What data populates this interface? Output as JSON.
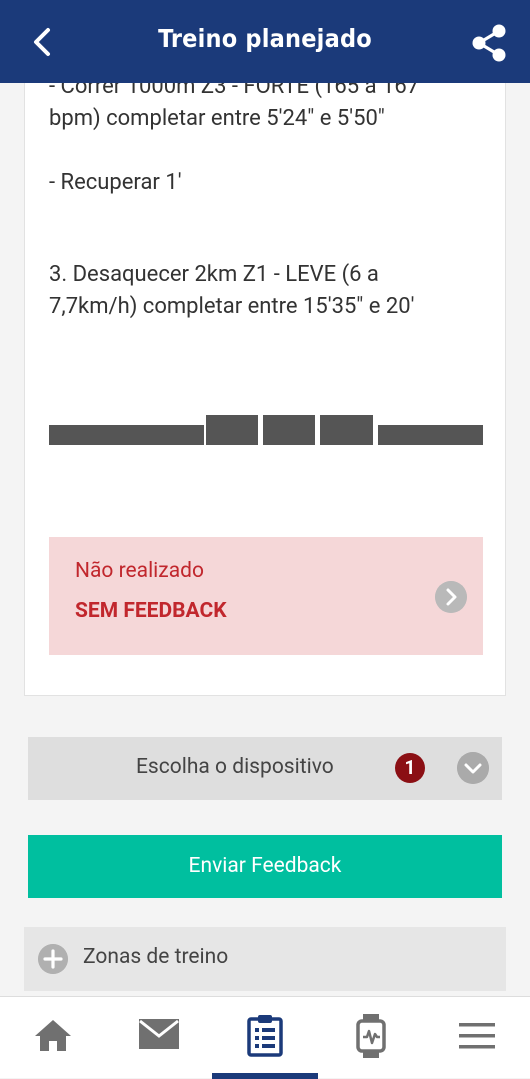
{
  "header": {
    "title": "Treino planejado",
    "back_icon": "chevron-left-icon",
    "share_icon": "share-icon"
  },
  "workout": {
    "partial_top_line": "- Correr 1000m Z3 - FORTE (165 a 167",
    "line_bpm": "bpm) completar entre 5'24\" e 5'50\"",
    "recover": "- Recuperar 1'",
    "step3_line1": "3. Desaquecer 2km Z1 - LEVE (6 a",
    "step3_line2": "7,7km/h) completar entre 15'35\" e 20'"
  },
  "status": {
    "line1": "Não realizado",
    "line2": "SEM FEEDBACK",
    "color": "#c1272d"
  },
  "device": {
    "label": "Escolha o dispositivo",
    "badge": "1"
  },
  "feedback_button": {
    "label": "Enviar Feedback",
    "color": "#00bf9f"
  },
  "zones": {
    "label": "Zonas de treino"
  },
  "nav": {
    "items": [
      {
        "name": "home-icon"
      },
      {
        "name": "mail-icon"
      },
      {
        "name": "clipboard-list-icon",
        "active": true
      },
      {
        "name": "smartwatch-icon"
      },
      {
        "name": "menu-icon"
      }
    ],
    "active_color": "#1b3a7a"
  },
  "colors": {
    "header_bg": "#1b3a7a",
    "badge_bg": "#8b0f14"
  }
}
